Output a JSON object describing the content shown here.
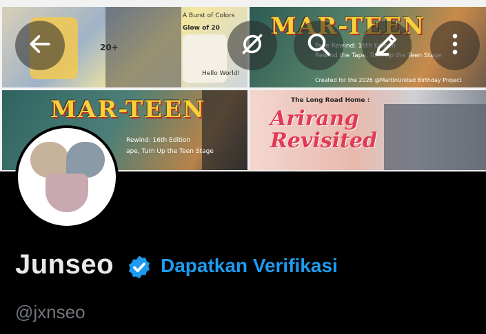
{
  "banner": {
    "tiles": [
      {
        "title": "Glow of 20",
        "sub": "A Burst of Colors",
        "tag": "20+",
        "extra": "Hello World!"
      },
      {
        "title": "MAR-TEEN",
        "sub": "Tape Rewind: 16th Edition",
        "sub2": "Rewind the Tape, Turn Up the Teen Stage",
        "credit": "Created for the 2026 @MartinUnited Birthday Project"
      },
      {
        "title": "MAR-TEEN",
        "sub": "Rewind: 16th Edition",
        "sub2": "ape, Turn Up the Teen Stage"
      },
      {
        "title": "Arirang Revisited",
        "sub": "The Long Road Home :"
      }
    ]
  },
  "toolbar": {
    "back_icon": "back-arrow-icon",
    "grok_icon": "grok-icon",
    "search_icon": "search-icon",
    "edit_icon": "edit-pencil-icon",
    "more_icon": "more-vertical-icon"
  },
  "profile": {
    "display_name": "Junseo",
    "verify_cta": "Dapatkan Verifikasi",
    "handle": "@jxnseo"
  },
  "colors": {
    "background": "#000000",
    "name": "#e7e9ea",
    "accent": "#1d9bf0",
    "handle": "#71767b"
  }
}
